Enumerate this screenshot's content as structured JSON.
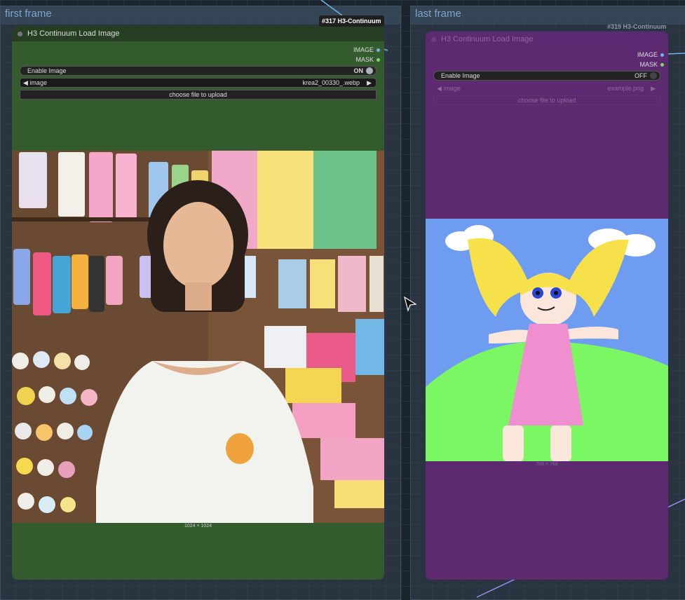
{
  "groups": [
    {
      "title": "first frame"
    },
    {
      "title": "last frame"
    }
  ],
  "nodes": [
    {
      "id_badge": "#317 H3-Continuum",
      "title": "H3 Continuum Load Image",
      "outputs": [
        "IMAGE",
        "MASK"
      ],
      "enable_label": "Enable Image",
      "enable_value": "ON",
      "image_label": "image",
      "image_value": "krea2_00330_.webp",
      "upload_label": "choose file to upload",
      "size_label": "1024 × 1024",
      "bg": "#335b2d"
    },
    {
      "id_badge": "#319 H3-Continuum",
      "title": "H3 Continuum Load Image",
      "outputs": [
        "IMAGE",
        "MASK"
      ],
      "enable_label": "Enable Image",
      "enable_value": "OFF",
      "image_label": "image",
      "image_value": "example.png",
      "upload_label": "choose file to upload",
      "size_label": "768 × 768",
      "bg": "#5d2a72"
    }
  ],
  "colors": {
    "link_image": "#6fb6e8",
    "link_mask": "#7bdc6a",
    "link_purple": "#9a8cf0"
  }
}
